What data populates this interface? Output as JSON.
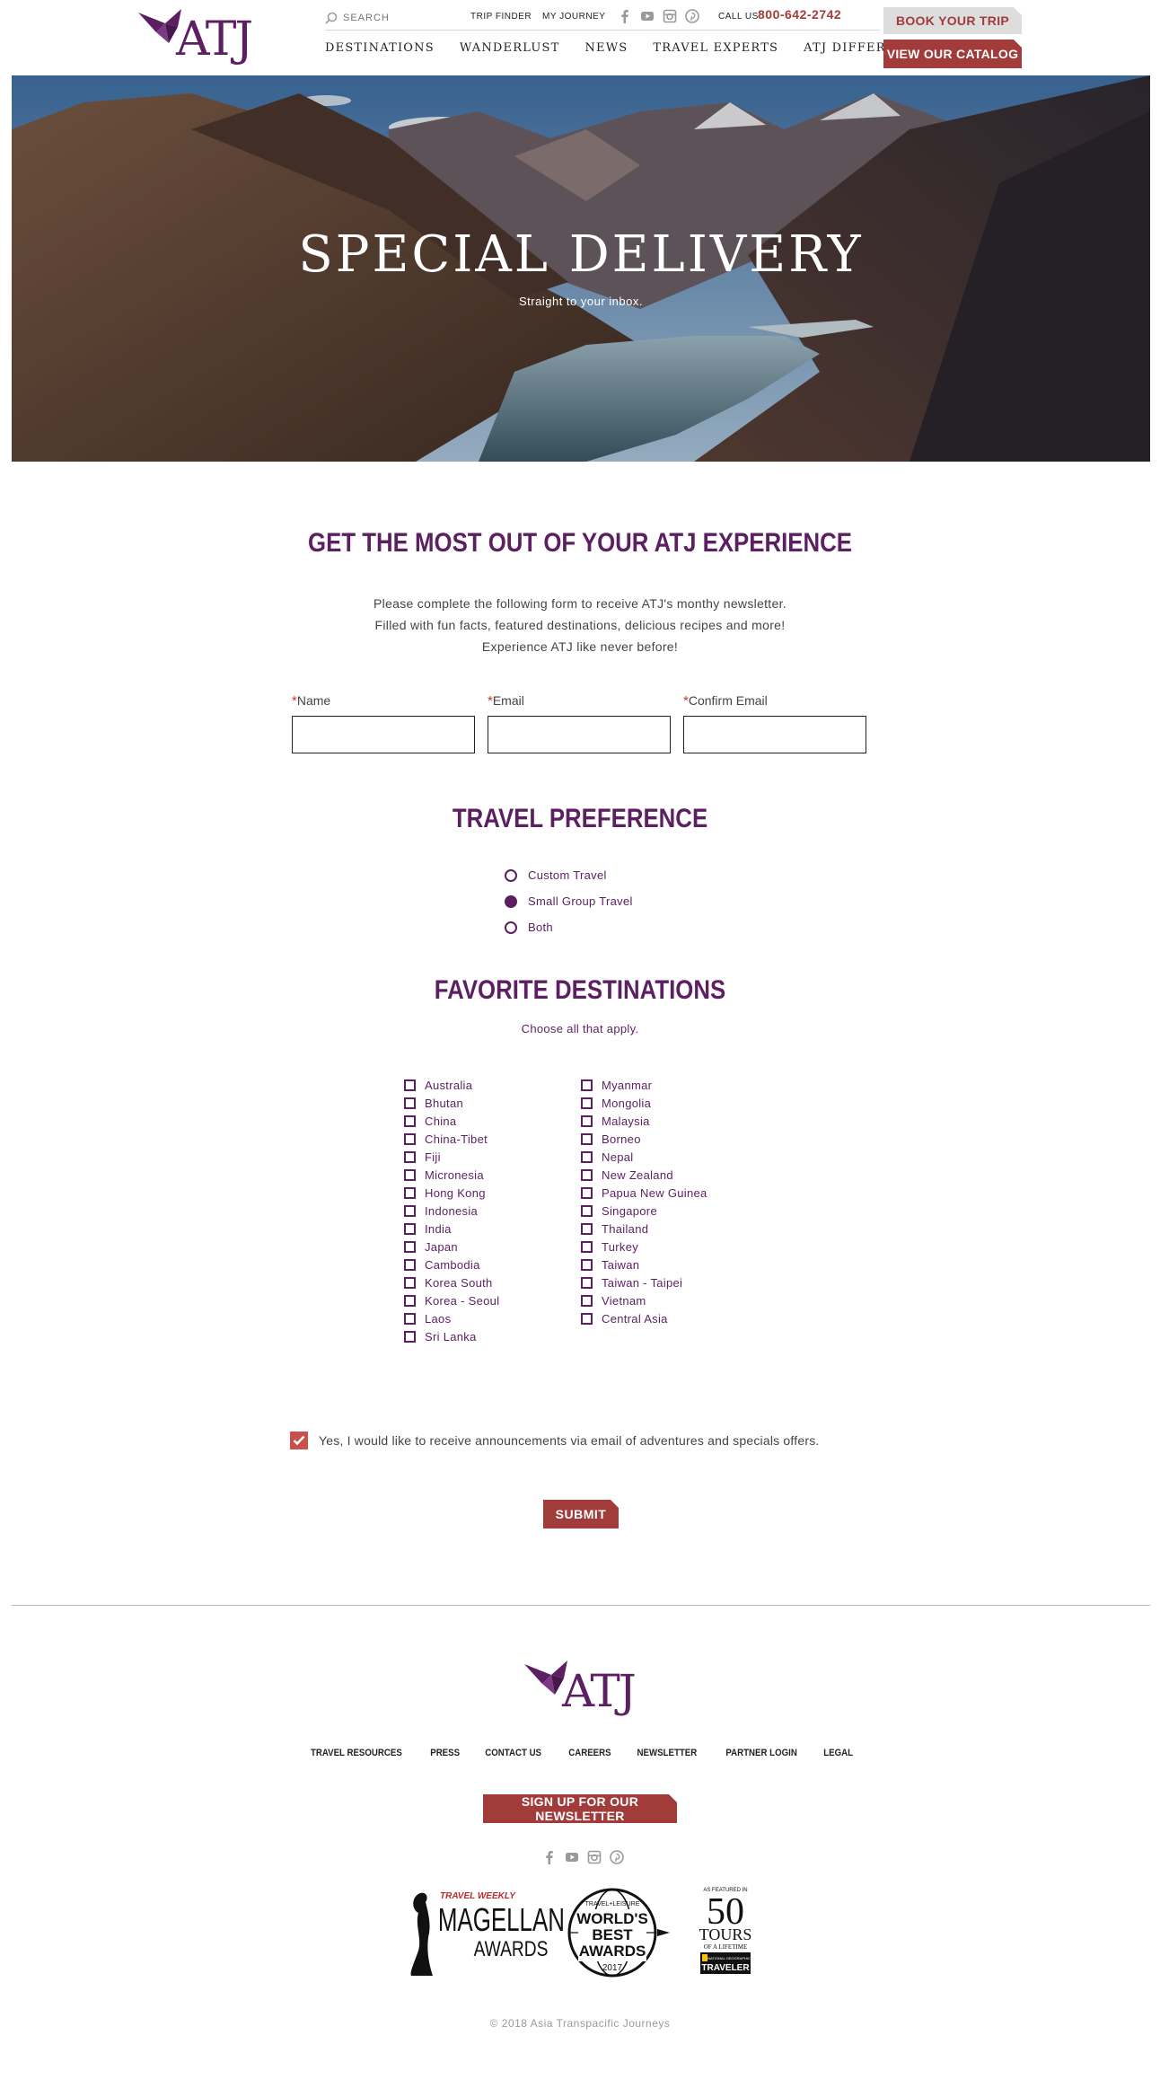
{
  "header": {
    "logo_text": "ATJ",
    "search_placeholder": "SEARCH",
    "util_links": [
      "TRIP FINDER",
      "MY JOURNEY"
    ],
    "social_icons": [
      "facebook-icon",
      "youtube-icon",
      "instagram-icon",
      "pinterest-icon"
    ],
    "call_label": "CALL US",
    "phone": "800-642-2742",
    "nav": [
      "DESTINATIONS",
      "WANDERLUST",
      "NEWS",
      "TRAVEL EXPERTS",
      "ATJ DIFFERENCE"
    ],
    "book_label": "BOOK YOUR TRIP",
    "catalog_label": "VIEW OUR CATALOG"
  },
  "hero": {
    "title": "SPECIAL DELIVERY",
    "subtitle": "Straight to your inbox."
  },
  "form": {
    "heading": "GET THE MOST OUT OF YOUR ATJ EXPERIENCE",
    "intro": [
      "Please complete the following form to receive ATJ's monthy newsletter.",
      "Filled with fun facts, featured destinations, delicious recipes and more!",
      "Experience ATJ like never before!"
    ],
    "required_mark": "*",
    "fields": [
      {
        "label": "Name",
        "value": ""
      },
      {
        "label": "Email",
        "value": ""
      },
      {
        "label": "Confirm Email",
        "value": ""
      }
    ],
    "travel_preference": {
      "heading": "TRAVEL PREFERENCE",
      "options": [
        "Custom Travel",
        "Small Group Travel",
        "Both"
      ],
      "selected": "Small Group Travel"
    },
    "favorite_destinations": {
      "heading": "FAVORITE DESTINATIONS",
      "instruction": "Choose all that apply.",
      "column1": [
        "Australia",
        "Bhutan",
        "China",
        "China-Tibet",
        "Fiji",
        "Micronesia",
        "Hong Kong",
        "Indonesia",
        "India",
        "Japan",
        "Cambodia",
        "Korea South",
        "Korea - Seoul",
        "Laos",
        "Sri Lanka"
      ],
      "column2": [
        "Myanmar",
        "Mongolia",
        "Malaysia",
        "Borneo",
        "Nepal",
        "New Zealand",
        "Papua New Guinea",
        "Singapore",
        "Thailand",
        "Turkey",
        "Taiwan",
        "Taiwan - Taipei",
        "Vietnam",
        "Central Asia"
      ]
    },
    "optin": {
      "label": "Yes, I would like to receive announcements via email of adventures and specials offers.",
      "checked": true
    },
    "submit_label": "SUBMIT"
  },
  "footer": {
    "logo_text": "ATJ",
    "links": [
      "TRAVEL RESOURCES",
      "PRESS",
      "CONTACT US",
      "CAREERS",
      "NEWSLETTER",
      "PARTNER LOGIN",
      "LEGAL"
    ],
    "newsletter_label": "SIGN UP FOR OUR NEWSLETTER",
    "social_icons": [
      "facebook-icon",
      "youtube-icon",
      "instagram-icon",
      "pinterest-icon"
    ],
    "awards": {
      "magellan": {
        "top": "TRAVEL WEEKLY",
        "line1": "MAGELLAN",
        "line2": "AWARDS"
      },
      "worlds_best": {
        "top": "TRAVEL+LEISURE",
        "line1": "WORLD'S",
        "line2": "BEST",
        "line3": "AWARDS",
        "year": "2017"
      },
      "tours": {
        "top": "AS FEATURED IN",
        "number": "50",
        "line1": "TOURS",
        "line2": "OF A LIFETIME",
        "badge_top": "NATIONAL GEOGRAPHIC",
        "badge": "TRAVELER"
      }
    },
    "copyright": "© 2018 Asia Transpacific Journeys"
  },
  "colors": {
    "brand_purple": "#5b1f62",
    "brand_red": "#a23c3b",
    "required_red": "#c0392b"
  }
}
